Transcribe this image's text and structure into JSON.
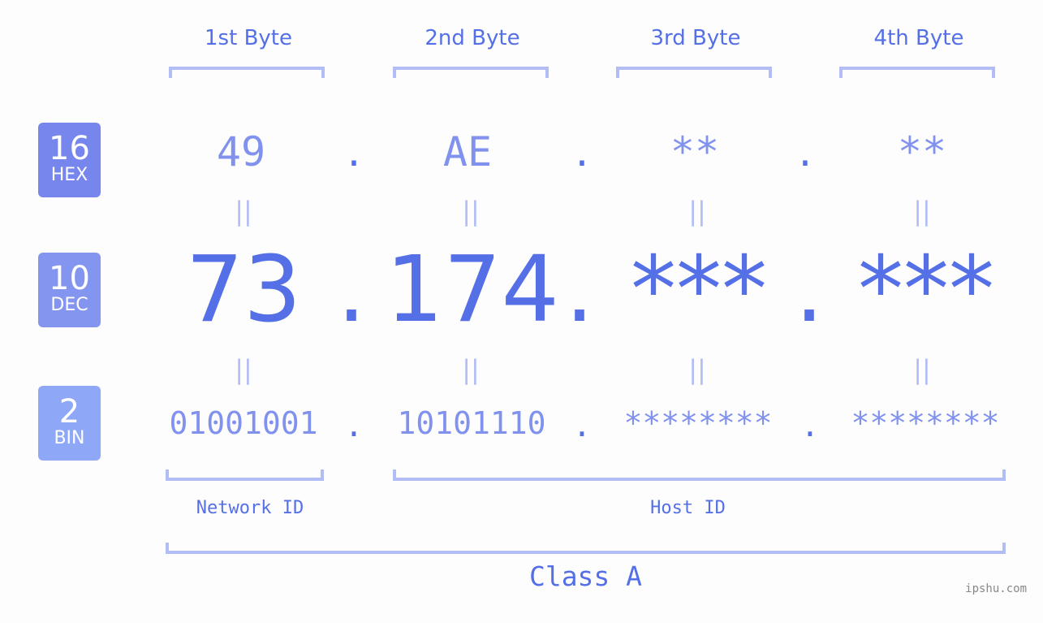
{
  "byte_headers": [
    "1st Byte",
    "2nd Byte",
    "3rd Byte",
    "4th Byte"
  ],
  "badges": {
    "hex": {
      "num": "16",
      "label": "HEX"
    },
    "dec": {
      "num": "10",
      "label": "DEC"
    },
    "bin": {
      "num": "2",
      "label": "BIN"
    }
  },
  "hex": [
    "49",
    "AE",
    "**",
    "**"
  ],
  "dec": [
    "73",
    "174",
    "***",
    "***"
  ],
  "bin": [
    "01001001",
    "10101110",
    "********",
    "********"
  ],
  "separator": ".",
  "equals": "||",
  "network_id_label": "Network ID",
  "host_id_label": "Host ID",
  "class_label": "Class A",
  "watermark": "ipshu.com",
  "colors": {
    "accent": "#5570e6",
    "light_value": "#8091ee",
    "bracket": "#b3bdf5",
    "badge_hex": "#7786ec",
    "badge_dec": "#8495f0",
    "badge_bin": "#8fa7f7"
  }
}
